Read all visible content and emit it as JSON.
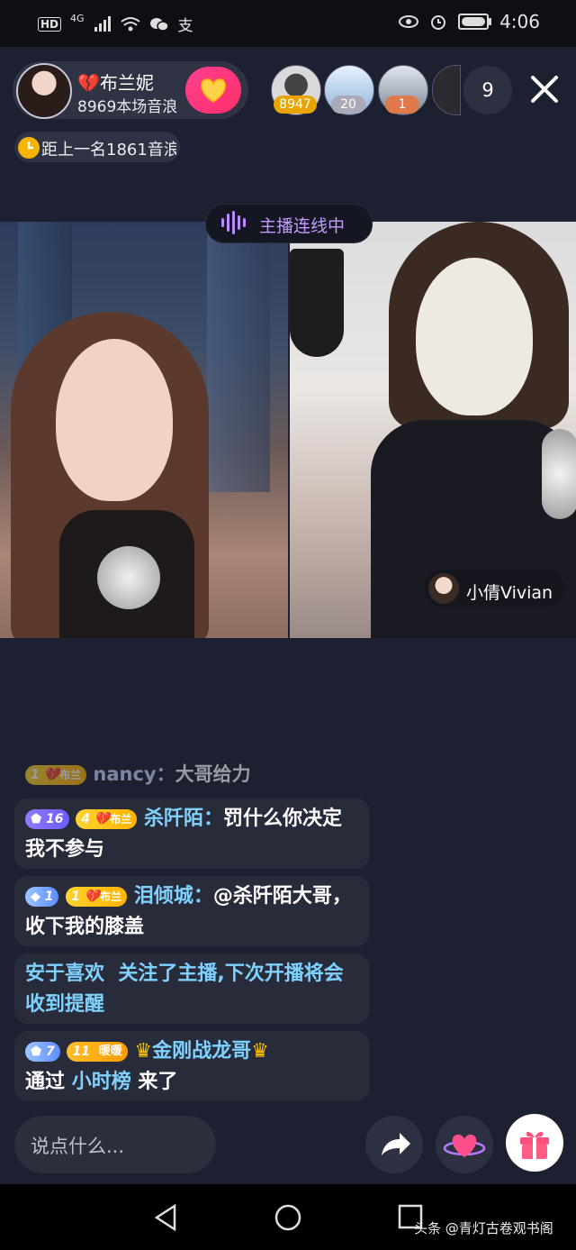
{
  "status_bar": {
    "left_items": [
      "HD",
      "4G",
      "支"
    ],
    "time": "4:06"
  },
  "host": {
    "name": "布兰妮",
    "sub": "8969本场音浪"
  },
  "viewers": [
    {
      "badge": "8947",
      "badge_color": "#e8a400"
    },
    {
      "badge": "20",
      "badge_color": "#a9a9b8"
    },
    {
      "badge": "1",
      "badge_color": "#e07a4c"
    }
  ],
  "viewer_count": "9",
  "rank_text": "距上一名1861音浪",
  "connect_text": "主播连线中",
  "guest_name": "小倩Vivian",
  "chat": [
    {
      "level": "1",
      "fan": "布兰",
      "user": "nancy：",
      "text": "大哥给力"
    },
    {
      "wealth": "16",
      "level": "4",
      "fan": "布兰",
      "user": "杀阡陌：",
      "text": "罚什么你决定 我不参与"
    },
    {
      "wealth": "1",
      "level": "1",
      "fan": "布兰",
      "user": "泪倾城：",
      "text": "@杀阡陌大哥，收下我的膝盖"
    },
    {
      "user": "安于喜欢",
      "text": "关注了主播,下次开播将会收到提醒"
    },
    {
      "wealth": "7",
      "level": "11",
      "fan": "暖暖",
      "user": "金刚战龙哥",
      "prefix": "通过",
      "highlight": "小时榜",
      "suffix": "来了"
    }
  ],
  "input_placeholder": "说点什么...",
  "watermark": "头条 @青灯古卷观书阁"
}
